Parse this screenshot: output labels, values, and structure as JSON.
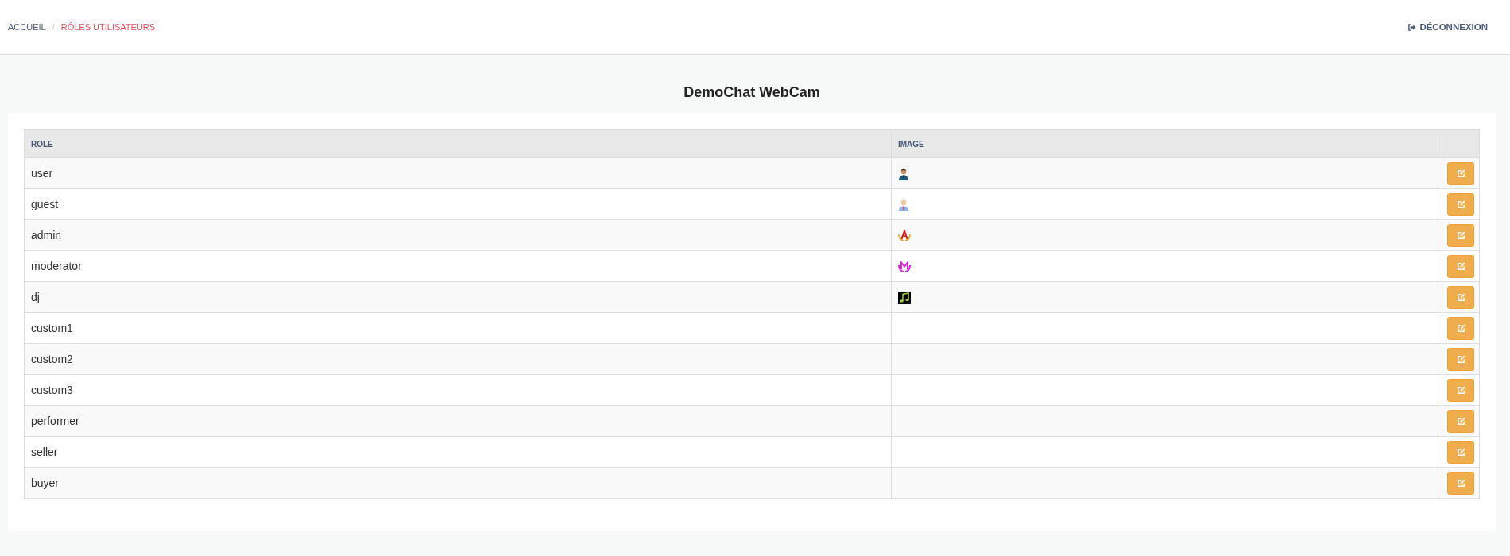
{
  "breadcrumb": [
    {
      "label": "ACCUEIL",
      "selected": false
    },
    {
      "label": "RÔLES UTILISATEURS",
      "selected": true
    }
  ],
  "breadcrumb_separator": "/",
  "logout": {
    "label": "DÉCONNEXION"
  },
  "title": "DemoChat WebCam",
  "table": {
    "columns": [
      "ROLE",
      "IMAGE"
    ],
    "rows": [
      {
        "role": "user",
        "kind": "persondark"
      },
      {
        "role": "guest",
        "kind": "personlight"
      },
      {
        "role": "admin",
        "kind": "lettera"
      },
      {
        "role": "moderator",
        "kind": "letterm"
      },
      {
        "role": "dj",
        "kind": "music"
      },
      {
        "role": "custom1",
        "kind": "plain"
      },
      {
        "role": "custom2",
        "kind": "plain"
      },
      {
        "role": "custom3",
        "kind": "plain"
      },
      {
        "role": "performer",
        "kind": "plain"
      },
      {
        "role": "seller",
        "kind": "plain"
      },
      {
        "role": "buyer",
        "kind": "plain"
      }
    ]
  }
}
